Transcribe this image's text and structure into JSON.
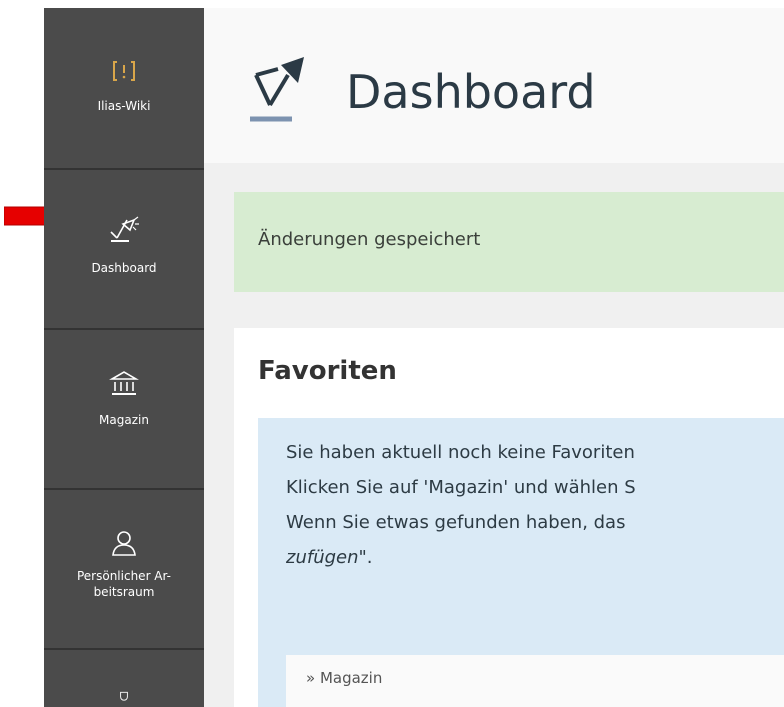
{
  "sidebar": {
    "items": [
      {
        "label": "Ilias-Wiki",
        "icon": "wiki-icon"
      },
      {
        "label": "Dashboard",
        "icon": "dashboard-lamp-icon"
      },
      {
        "label": "Magazin",
        "icon": "magazine-building-icon"
      },
      {
        "label_line1": "Persönlicher Ar-",
        "label_line2": "beitsraum",
        "icon": "person-icon"
      },
      {
        "icon": "trophy-icon"
      }
    ]
  },
  "header": {
    "title": "Dashboard",
    "icon": "dashboard-lamp-icon"
  },
  "alert": {
    "message": "Änderungen gespeichert"
  },
  "favorites": {
    "title": "Favoriten",
    "line1": "Sie haben aktuell noch keine Favoriten",
    "line2": "Klicken Sie auf 'Magazin' und wählen S",
    "line3": "Wenn Sie etwas gefunden haben, das",
    "line4_em": "zufügen",
    "line4_suffix": "\".",
    "link": "» Magazin"
  },
  "annotation": {
    "arrow_color": "#e60000"
  }
}
